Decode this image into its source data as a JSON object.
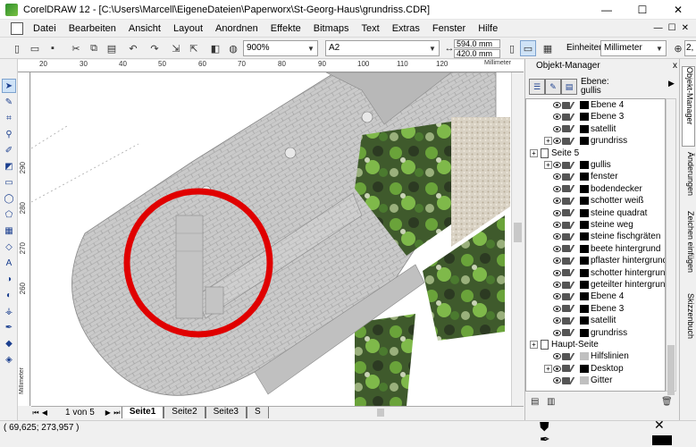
{
  "window": {
    "title": "CorelDRAW 12 - [C:\\Users\\Marcell\\EigeneDateien\\Paperworx\\St-Georg-Haus\\grundriss.CDR]",
    "minimize": "—",
    "maximize": "☐",
    "close": "✕"
  },
  "menu": {
    "items": [
      "Datei",
      "Bearbeiten",
      "Ansicht",
      "Layout",
      "Anordnen",
      "Effekte",
      "Bitmaps",
      "Text",
      "Extras",
      "Fenster",
      "Hilfe"
    ],
    "mdi_min": "—",
    "mdi_max": "☐",
    "mdi_close": "✕"
  },
  "toolbar": {
    "zoom": "900%",
    "paper": "A2",
    "width": "594.0 mm",
    "height": "420.0 mm",
    "units_label": "Einheiten:",
    "units": "Millimeter",
    "nudge": "2,"
  },
  "ruler": {
    "h_ticks": [
      "20",
      "30",
      "40",
      "50",
      "60",
      "70",
      "80",
      "90",
      "100",
      "110",
      "120"
    ],
    "h_unit": "Millimeter",
    "v_ticks": [
      "290",
      "280",
      "270",
      "260"
    ],
    "v_unit": "Millimeter"
  },
  "pages": {
    "count": "1 von 5",
    "tabs": [
      "Seite1",
      "Seite2",
      "Seite3",
      "S"
    ],
    "active": "Seite1"
  },
  "status": {
    "coords": "( 69,625; 273,957 )"
  },
  "docker": {
    "title": "Objekt-Manager",
    "close": "x",
    "ebene_label": "Ebene:",
    "ebene_value": "gullis",
    "tree": [
      {
        "label": "Ebene 4",
        "indent": 2,
        "swatch": "black",
        "exp": false
      },
      {
        "label": "Ebene 3",
        "indent": 2,
        "swatch": "black",
        "exp": false
      },
      {
        "label": "satellit",
        "indent": 2,
        "swatch": "black",
        "exp": false
      },
      {
        "label": "grundriss",
        "indent": 2,
        "swatch": "black",
        "exp": true
      },
      {
        "label": "Seite 5",
        "indent": 0,
        "page": true,
        "exp": true
      },
      {
        "label": "gullis",
        "indent": 2,
        "swatch": "black",
        "exp": true
      },
      {
        "label": "fenster",
        "indent": 2,
        "swatch": "black",
        "exp": false
      },
      {
        "label": "bodendecker",
        "indent": 2,
        "swatch": "black",
        "exp": false
      },
      {
        "label": "schotter weiß",
        "indent": 2,
        "swatch": "black",
        "exp": false
      },
      {
        "label": "steine quadrat",
        "indent": 2,
        "swatch": "black",
        "exp": false
      },
      {
        "label": "steine weg",
        "indent": 2,
        "swatch": "black",
        "exp": false
      },
      {
        "label": "steine fischgräten",
        "indent": 2,
        "swatch": "black",
        "exp": false
      },
      {
        "label": "beete hintergrund",
        "indent": 2,
        "swatch": "black",
        "exp": false
      },
      {
        "label": "pflaster hintergrund",
        "indent": 2,
        "swatch": "black",
        "exp": false
      },
      {
        "label": "schotter hintergrund",
        "indent": 2,
        "swatch": "black",
        "exp": false
      },
      {
        "label": "geteilter hintergrund",
        "indent": 2,
        "swatch": "black",
        "exp": false
      },
      {
        "label": "Ebene 4",
        "indent": 2,
        "swatch": "black",
        "exp": false
      },
      {
        "label": "Ebene 3",
        "indent": 2,
        "swatch": "black",
        "exp": false
      },
      {
        "label": "satellit",
        "indent": 2,
        "swatch": "black",
        "exp": false
      },
      {
        "label": "grundriss",
        "indent": 2,
        "swatch": "black",
        "exp": false
      },
      {
        "label": "Haupt-Seite",
        "indent": 0,
        "page": true,
        "exp": true
      },
      {
        "label": "Hilfslinien",
        "indent": 2,
        "swatch": "gray",
        "exp": false
      },
      {
        "label": "Desktop",
        "indent": 2,
        "swatch": "black",
        "exp": true
      },
      {
        "label": "Gitter",
        "indent": 2,
        "swatch": "gray",
        "exp": false
      }
    ]
  },
  "side_tabs": [
    "Objekt-Manager",
    "Änderungen",
    "Zeichen einfügen",
    "Skizzenbuch"
  ],
  "colors": {
    "paving": "#c9c9c9",
    "path": "#bdbdbd",
    "circle": "#e00000",
    "moss": "#3d6b2a"
  }
}
